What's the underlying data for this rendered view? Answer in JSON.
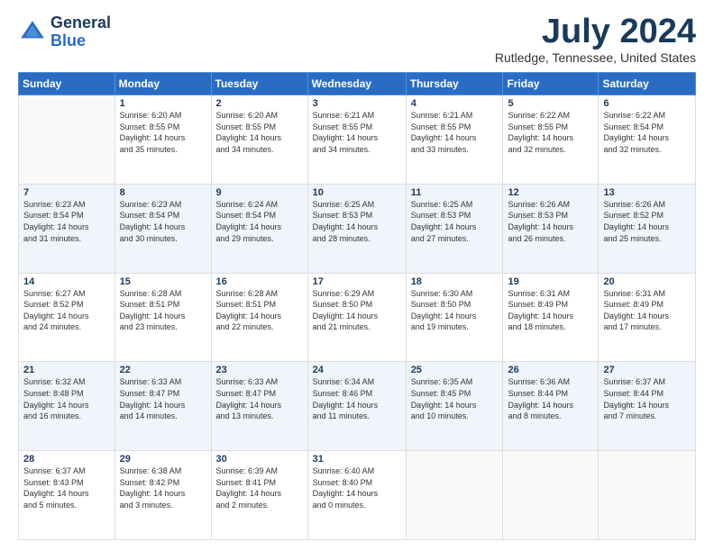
{
  "logo": {
    "text_general": "General",
    "text_blue": "Blue"
  },
  "header": {
    "month_title": "July 2024",
    "location": "Rutledge, Tennessee, United States"
  },
  "days_of_week": [
    "Sunday",
    "Monday",
    "Tuesday",
    "Wednesday",
    "Thursday",
    "Friday",
    "Saturday"
  ],
  "weeks": [
    [
      {
        "day": "",
        "info": ""
      },
      {
        "day": "1",
        "info": "Sunrise: 6:20 AM\nSunset: 8:55 PM\nDaylight: 14 hours\nand 35 minutes."
      },
      {
        "day": "2",
        "info": "Sunrise: 6:20 AM\nSunset: 8:55 PM\nDaylight: 14 hours\nand 34 minutes."
      },
      {
        "day": "3",
        "info": "Sunrise: 6:21 AM\nSunset: 8:55 PM\nDaylight: 14 hours\nand 34 minutes."
      },
      {
        "day": "4",
        "info": "Sunrise: 6:21 AM\nSunset: 8:55 PM\nDaylight: 14 hours\nand 33 minutes."
      },
      {
        "day": "5",
        "info": "Sunrise: 6:22 AM\nSunset: 8:55 PM\nDaylight: 14 hours\nand 32 minutes."
      },
      {
        "day": "6",
        "info": "Sunrise: 6:22 AM\nSunset: 8:54 PM\nDaylight: 14 hours\nand 32 minutes."
      }
    ],
    [
      {
        "day": "7",
        "info": "Sunrise: 6:23 AM\nSunset: 8:54 PM\nDaylight: 14 hours\nand 31 minutes."
      },
      {
        "day": "8",
        "info": "Sunrise: 6:23 AM\nSunset: 8:54 PM\nDaylight: 14 hours\nand 30 minutes."
      },
      {
        "day": "9",
        "info": "Sunrise: 6:24 AM\nSunset: 8:54 PM\nDaylight: 14 hours\nand 29 minutes."
      },
      {
        "day": "10",
        "info": "Sunrise: 6:25 AM\nSunset: 8:53 PM\nDaylight: 14 hours\nand 28 minutes."
      },
      {
        "day": "11",
        "info": "Sunrise: 6:25 AM\nSunset: 8:53 PM\nDaylight: 14 hours\nand 27 minutes."
      },
      {
        "day": "12",
        "info": "Sunrise: 6:26 AM\nSunset: 8:53 PM\nDaylight: 14 hours\nand 26 minutes."
      },
      {
        "day": "13",
        "info": "Sunrise: 6:26 AM\nSunset: 8:52 PM\nDaylight: 14 hours\nand 25 minutes."
      }
    ],
    [
      {
        "day": "14",
        "info": "Sunrise: 6:27 AM\nSunset: 8:52 PM\nDaylight: 14 hours\nand 24 minutes."
      },
      {
        "day": "15",
        "info": "Sunrise: 6:28 AM\nSunset: 8:51 PM\nDaylight: 14 hours\nand 23 minutes."
      },
      {
        "day": "16",
        "info": "Sunrise: 6:28 AM\nSunset: 8:51 PM\nDaylight: 14 hours\nand 22 minutes."
      },
      {
        "day": "17",
        "info": "Sunrise: 6:29 AM\nSunset: 8:50 PM\nDaylight: 14 hours\nand 21 minutes."
      },
      {
        "day": "18",
        "info": "Sunrise: 6:30 AM\nSunset: 8:50 PM\nDaylight: 14 hours\nand 19 minutes."
      },
      {
        "day": "19",
        "info": "Sunrise: 6:31 AM\nSunset: 8:49 PM\nDaylight: 14 hours\nand 18 minutes."
      },
      {
        "day": "20",
        "info": "Sunrise: 6:31 AM\nSunset: 8:49 PM\nDaylight: 14 hours\nand 17 minutes."
      }
    ],
    [
      {
        "day": "21",
        "info": "Sunrise: 6:32 AM\nSunset: 8:48 PM\nDaylight: 14 hours\nand 16 minutes."
      },
      {
        "day": "22",
        "info": "Sunrise: 6:33 AM\nSunset: 8:47 PM\nDaylight: 14 hours\nand 14 minutes."
      },
      {
        "day": "23",
        "info": "Sunrise: 6:33 AM\nSunset: 8:47 PM\nDaylight: 14 hours\nand 13 minutes."
      },
      {
        "day": "24",
        "info": "Sunrise: 6:34 AM\nSunset: 8:46 PM\nDaylight: 14 hours\nand 11 minutes."
      },
      {
        "day": "25",
        "info": "Sunrise: 6:35 AM\nSunset: 8:45 PM\nDaylight: 14 hours\nand 10 minutes."
      },
      {
        "day": "26",
        "info": "Sunrise: 6:36 AM\nSunset: 8:44 PM\nDaylight: 14 hours\nand 8 minutes."
      },
      {
        "day": "27",
        "info": "Sunrise: 6:37 AM\nSunset: 8:44 PM\nDaylight: 14 hours\nand 7 minutes."
      }
    ],
    [
      {
        "day": "28",
        "info": "Sunrise: 6:37 AM\nSunset: 8:43 PM\nDaylight: 14 hours\nand 5 minutes."
      },
      {
        "day": "29",
        "info": "Sunrise: 6:38 AM\nSunset: 8:42 PM\nDaylight: 14 hours\nand 3 minutes."
      },
      {
        "day": "30",
        "info": "Sunrise: 6:39 AM\nSunset: 8:41 PM\nDaylight: 14 hours\nand 2 minutes."
      },
      {
        "day": "31",
        "info": "Sunrise: 6:40 AM\nSunset: 8:40 PM\nDaylight: 14 hours\nand 0 minutes."
      },
      {
        "day": "",
        "info": ""
      },
      {
        "day": "",
        "info": ""
      },
      {
        "day": "",
        "info": ""
      }
    ]
  ]
}
